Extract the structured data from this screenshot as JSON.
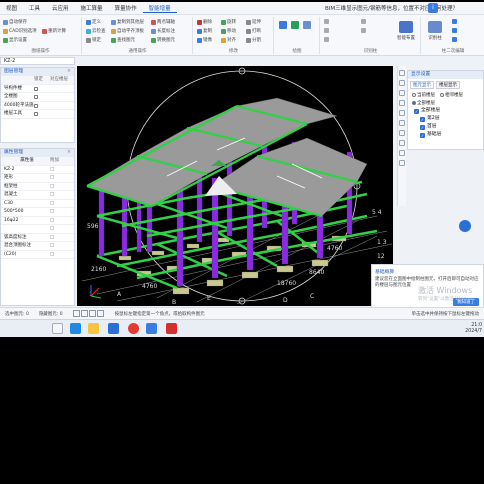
{
  "menu": [
    "视图",
    "工具",
    "云应用",
    "施工算量",
    "算量协作",
    "智能增量"
  ],
  "menu_active_index": 5,
  "banner_text": "BIM三维显示图元/钢筋等信息，位置不对应如何处理？",
  "ribbon": {
    "group1": {
      "items": [
        "自动保存",
        "CAD识别选项",
        "显示设置",
        "重新计算"
      ],
      "label": "图纸操作"
    },
    "group2": {
      "items": [
        "定义",
        "云检查",
        "锁定",
        "复制到其他层",
        "自动平齐顶板",
        "两点辅轴",
        "长度标注",
        "查找图元",
        "转换图元",
        "图元存盘"
      ],
      "label": "通用操作"
    },
    "group3": {
      "items": [
        "删除",
        "复制",
        "镜像",
        "旋转",
        "移动",
        "对齐",
        "延伸",
        "打断",
        "分割",
        "偏移",
        "合并"
      ],
      "label": "修改"
    },
    "group4": {
      "label": "绘图"
    },
    "group5": {
      "label": "识别柱"
    },
    "group6": {
      "label": "柱二次编辑"
    },
    "bigbtns": [
      "智能布置",
      "识别柱"
    ]
  },
  "left_panel1": {
    "title": "图层管理",
    "header": [
      "",
      "锁定",
      "对应楼层"
    ],
    "rows": [
      "导构件楼",
      "全楼图",
      "4000轮平法施",
      "楼层工具"
    ]
  },
  "left_panel2": {
    "title": "属性管理",
    "header": [
      "属性值",
      "附加"
    ],
    "rows": [
      "KZ-2",
      "矩形",
      "框架柱",
      "混凝土",
      "C30",
      "500*500",
      "16φ22",
      "",
      "弧高度标注",
      "混合顶图标注",
      "(C20)"
    ]
  },
  "panel_head_floor": "KZ-2",
  "right_panel": {
    "title": "显示设置",
    "tabs": [
      "图元显示",
      "楼层显示"
    ],
    "radios": [
      "当前楼层",
      "相邻楼层",
      "全部楼层"
    ],
    "tree": [
      "全部楼层",
      "第2层",
      "首层",
      "基础层"
    ]
  },
  "viewport_labels": [
    "5 4",
    "1 3",
    "12",
    "1 4760",
    "3",
    "4760",
    "18760",
    "D",
    "E",
    "C",
    "B",
    "A",
    "15",
    "596",
    "2160",
    "4760",
    "8640",
    "1",
    "2",
    "6"
  ],
  "notification": {
    "title": "基础概算",
    "body": "建议您在立面图中绘制柱图元，打开后即可自动对应的楼层与图元位置",
    "button": "我知道了"
  },
  "watermark": "激活 Windows",
  "watermark_sub": "转到\"设置\"以激活 Windows",
  "status": {
    "floor": "选中图元: 0",
    "hidden": "隐藏图元: 0",
    "hint": "按鼠标左键指定第一个角点，或拾取构件图元",
    "right": "单击选中并保持按下鼠标左键拖动"
  },
  "clock": {
    "time": "21:0",
    "date": "2024/7"
  },
  "colors": {
    "accent": "#1f5fbf",
    "column": "#8a2be2",
    "beam": "#2ecc40",
    "slab": "#9a9a9a"
  }
}
